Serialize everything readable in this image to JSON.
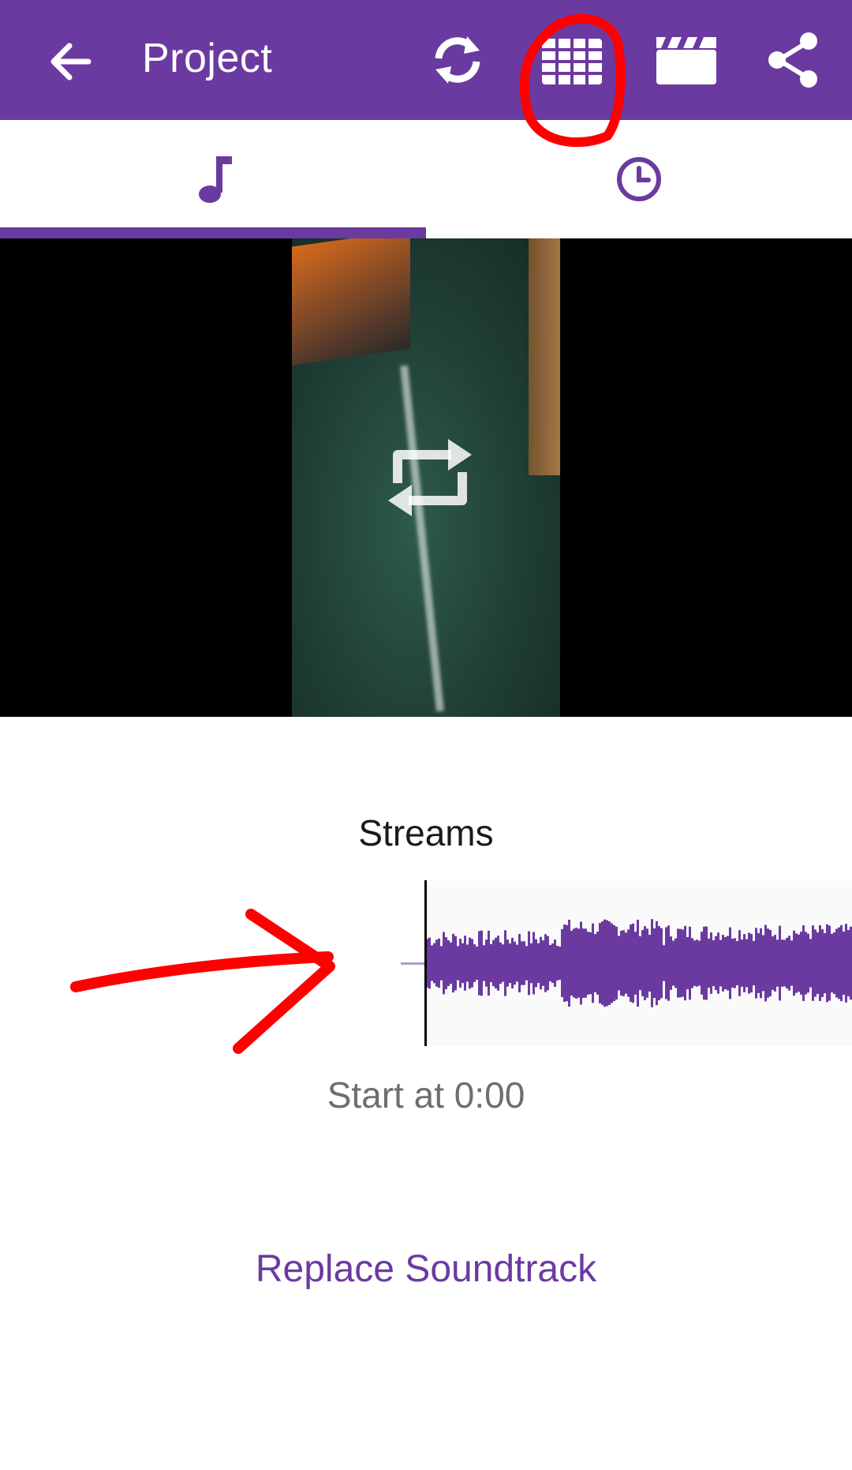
{
  "colors": {
    "brand": "#6b3aa0",
    "annotation": "#ff0000",
    "background": "#ffffff"
  },
  "appbar": {
    "title": "Project",
    "back_icon": "arrow-left-icon",
    "actions": [
      {
        "icon": "refresh-icon"
      },
      {
        "icon": "grid-icon"
      },
      {
        "icon": "clapperboard-icon"
      },
      {
        "icon": "share-icon"
      }
    ]
  },
  "tabs": [
    {
      "icon": "music-note-icon",
      "selected": true
    },
    {
      "icon": "clock-icon",
      "selected": false
    }
  ],
  "video": {
    "overlay_icon": "repeat-icon"
  },
  "soundtrack": {
    "name": "Streams",
    "start_label": "Start at 0:00",
    "replace_label": "Replace Soundtrack"
  }
}
